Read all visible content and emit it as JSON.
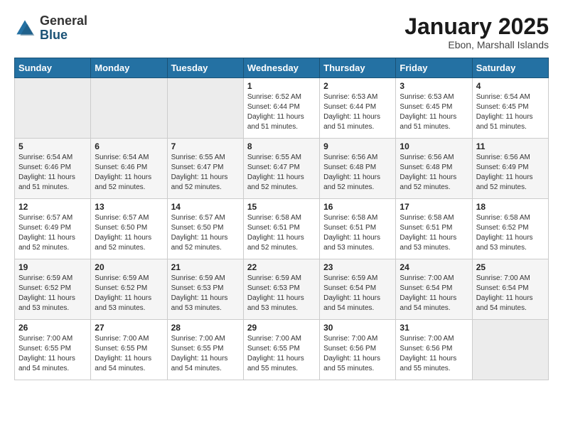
{
  "header": {
    "logo_general": "General",
    "logo_blue": "Blue",
    "month_title": "January 2025",
    "location": "Ebon, Marshall Islands"
  },
  "weekdays": [
    "Sunday",
    "Monday",
    "Tuesday",
    "Wednesday",
    "Thursday",
    "Friday",
    "Saturday"
  ],
  "weeks": [
    [
      {
        "day": "",
        "sunrise": "",
        "sunset": "",
        "daylight": ""
      },
      {
        "day": "",
        "sunrise": "",
        "sunset": "",
        "daylight": ""
      },
      {
        "day": "",
        "sunrise": "",
        "sunset": "",
        "daylight": ""
      },
      {
        "day": "1",
        "sunrise": "Sunrise: 6:52 AM",
        "sunset": "Sunset: 6:44 PM",
        "daylight": "Daylight: 11 hours and 51 minutes."
      },
      {
        "day": "2",
        "sunrise": "Sunrise: 6:53 AM",
        "sunset": "Sunset: 6:44 PM",
        "daylight": "Daylight: 11 hours and 51 minutes."
      },
      {
        "day": "3",
        "sunrise": "Sunrise: 6:53 AM",
        "sunset": "Sunset: 6:45 PM",
        "daylight": "Daylight: 11 hours and 51 minutes."
      },
      {
        "day": "4",
        "sunrise": "Sunrise: 6:54 AM",
        "sunset": "Sunset: 6:45 PM",
        "daylight": "Daylight: 11 hours and 51 minutes."
      }
    ],
    [
      {
        "day": "5",
        "sunrise": "Sunrise: 6:54 AM",
        "sunset": "Sunset: 6:46 PM",
        "daylight": "Daylight: 11 hours and 51 minutes."
      },
      {
        "day": "6",
        "sunrise": "Sunrise: 6:54 AM",
        "sunset": "Sunset: 6:46 PM",
        "daylight": "Daylight: 11 hours and 52 minutes."
      },
      {
        "day": "7",
        "sunrise": "Sunrise: 6:55 AM",
        "sunset": "Sunset: 6:47 PM",
        "daylight": "Daylight: 11 hours and 52 minutes."
      },
      {
        "day": "8",
        "sunrise": "Sunrise: 6:55 AM",
        "sunset": "Sunset: 6:47 PM",
        "daylight": "Daylight: 11 hours and 52 minutes."
      },
      {
        "day": "9",
        "sunrise": "Sunrise: 6:56 AM",
        "sunset": "Sunset: 6:48 PM",
        "daylight": "Daylight: 11 hours and 52 minutes."
      },
      {
        "day": "10",
        "sunrise": "Sunrise: 6:56 AM",
        "sunset": "Sunset: 6:48 PM",
        "daylight": "Daylight: 11 hours and 52 minutes."
      },
      {
        "day": "11",
        "sunrise": "Sunrise: 6:56 AM",
        "sunset": "Sunset: 6:49 PM",
        "daylight": "Daylight: 11 hours and 52 minutes."
      }
    ],
    [
      {
        "day": "12",
        "sunrise": "Sunrise: 6:57 AM",
        "sunset": "Sunset: 6:49 PM",
        "daylight": "Daylight: 11 hours and 52 minutes."
      },
      {
        "day": "13",
        "sunrise": "Sunrise: 6:57 AM",
        "sunset": "Sunset: 6:50 PM",
        "daylight": "Daylight: 11 hours and 52 minutes."
      },
      {
        "day": "14",
        "sunrise": "Sunrise: 6:57 AM",
        "sunset": "Sunset: 6:50 PM",
        "daylight": "Daylight: 11 hours and 52 minutes."
      },
      {
        "day": "15",
        "sunrise": "Sunrise: 6:58 AM",
        "sunset": "Sunset: 6:51 PM",
        "daylight": "Daylight: 11 hours and 52 minutes."
      },
      {
        "day": "16",
        "sunrise": "Sunrise: 6:58 AM",
        "sunset": "Sunset: 6:51 PM",
        "daylight": "Daylight: 11 hours and 53 minutes."
      },
      {
        "day": "17",
        "sunrise": "Sunrise: 6:58 AM",
        "sunset": "Sunset: 6:51 PM",
        "daylight": "Daylight: 11 hours and 53 minutes."
      },
      {
        "day": "18",
        "sunrise": "Sunrise: 6:58 AM",
        "sunset": "Sunset: 6:52 PM",
        "daylight": "Daylight: 11 hours and 53 minutes."
      }
    ],
    [
      {
        "day": "19",
        "sunrise": "Sunrise: 6:59 AM",
        "sunset": "Sunset: 6:52 PM",
        "daylight": "Daylight: 11 hours and 53 minutes."
      },
      {
        "day": "20",
        "sunrise": "Sunrise: 6:59 AM",
        "sunset": "Sunset: 6:52 PM",
        "daylight": "Daylight: 11 hours and 53 minutes."
      },
      {
        "day": "21",
        "sunrise": "Sunrise: 6:59 AM",
        "sunset": "Sunset: 6:53 PM",
        "daylight": "Daylight: 11 hours and 53 minutes."
      },
      {
        "day": "22",
        "sunrise": "Sunrise: 6:59 AM",
        "sunset": "Sunset: 6:53 PM",
        "daylight": "Daylight: 11 hours and 53 minutes."
      },
      {
        "day": "23",
        "sunrise": "Sunrise: 6:59 AM",
        "sunset": "Sunset: 6:54 PM",
        "daylight": "Daylight: 11 hours and 54 minutes."
      },
      {
        "day": "24",
        "sunrise": "Sunrise: 7:00 AM",
        "sunset": "Sunset: 6:54 PM",
        "daylight": "Daylight: 11 hours and 54 minutes."
      },
      {
        "day": "25",
        "sunrise": "Sunrise: 7:00 AM",
        "sunset": "Sunset: 6:54 PM",
        "daylight": "Daylight: 11 hours and 54 minutes."
      }
    ],
    [
      {
        "day": "26",
        "sunrise": "Sunrise: 7:00 AM",
        "sunset": "Sunset: 6:55 PM",
        "daylight": "Daylight: 11 hours and 54 minutes."
      },
      {
        "day": "27",
        "sunrise": "Sunrise: 7:00 AM",
        "sunset": "Sunset: 6:55 PM",
        "daylight": "Daylight: 11 hours and 54 minutes."
      },
      {
        "day": "28",
        "sunrise": "Sunrise: 7:00 AM",
        "sunset": "Sunset: 6:55 PM",
        "daylight": "Daylight: 11 hours and 54 minutes."
      },
      {
        "day": "29",
        "sunrise": "Sunrise: 7:00 AM",
        "sunset": "Sunset: 6:55 PM",
        "daylight": "Daylight: 11 hours and 55 minutes."
      },
      {
        "day": "30",
        "sunrise": "Sunrise: 7:00 AM",
        "sunset": "Sunset: 6:56 PM",
        "daylight": "Daylight: 11 hours and 55 minutes."
      },
      {
        "day": "31",
        "sunrise": "Sunrise: 7:00 AM",
        "sunset": "Sunset: 6:56 PM",
        "daylight": "Daylight: 11 hours and 55 minutes."
      },
      {
        "day": "",
        "sunrise": "",
        "sunset": "",
        "daylight": ""
      }
    ]
  ]
}
